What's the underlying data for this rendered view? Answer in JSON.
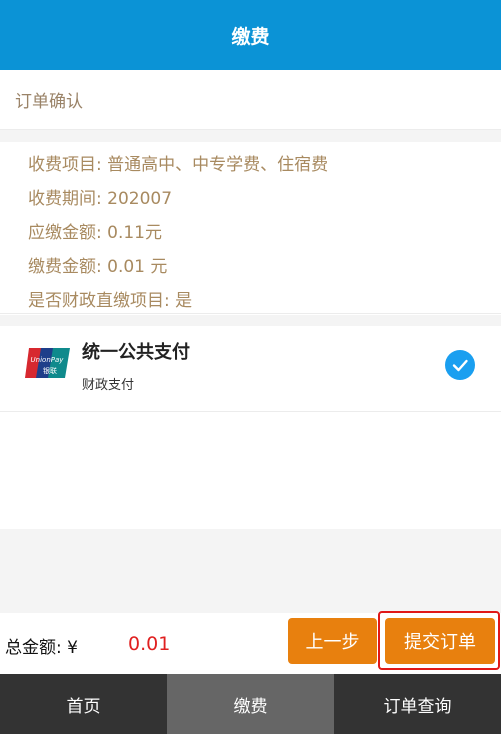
{
  "header": {
    "title": "缴费"
  },
  "order": {
    "section_title": "订单确认"
  },
  "details": [
    "收费项目: 普通高中、中专学费、住宿费",
    "收费期间: 202007",
    "应缴金额: 0.11元",
    "缴费金额: 0.01 元",
    "是否财政直缴项目: 是"
  ],
  "payment": {
    "name": "统一公共支付",
    "sub": "财政支付",
    "selected": true,
    "icon": "unionpay-icon"
  },
  "footer": {
    "total_label": "总金额: ¥",
    "total_value": "0.01",
    "prev_label": "上一步",
    "submit_label": "提交订单"
  },
  "tabs": [
    {
      "label": "首页",
      "active": false
    },
    {
      "label": "缴费",
      "active": true
    },
    {
      "label": "订单查询",
      "active": false
    }
  ],
  "colors": {
    "header": "#0b93d6",
    "accent": "#e8800e",
    "detail_text": "#a88a60",
    "total_value": "#e02020",
    "check": "#1a9ff0"
  }
}
